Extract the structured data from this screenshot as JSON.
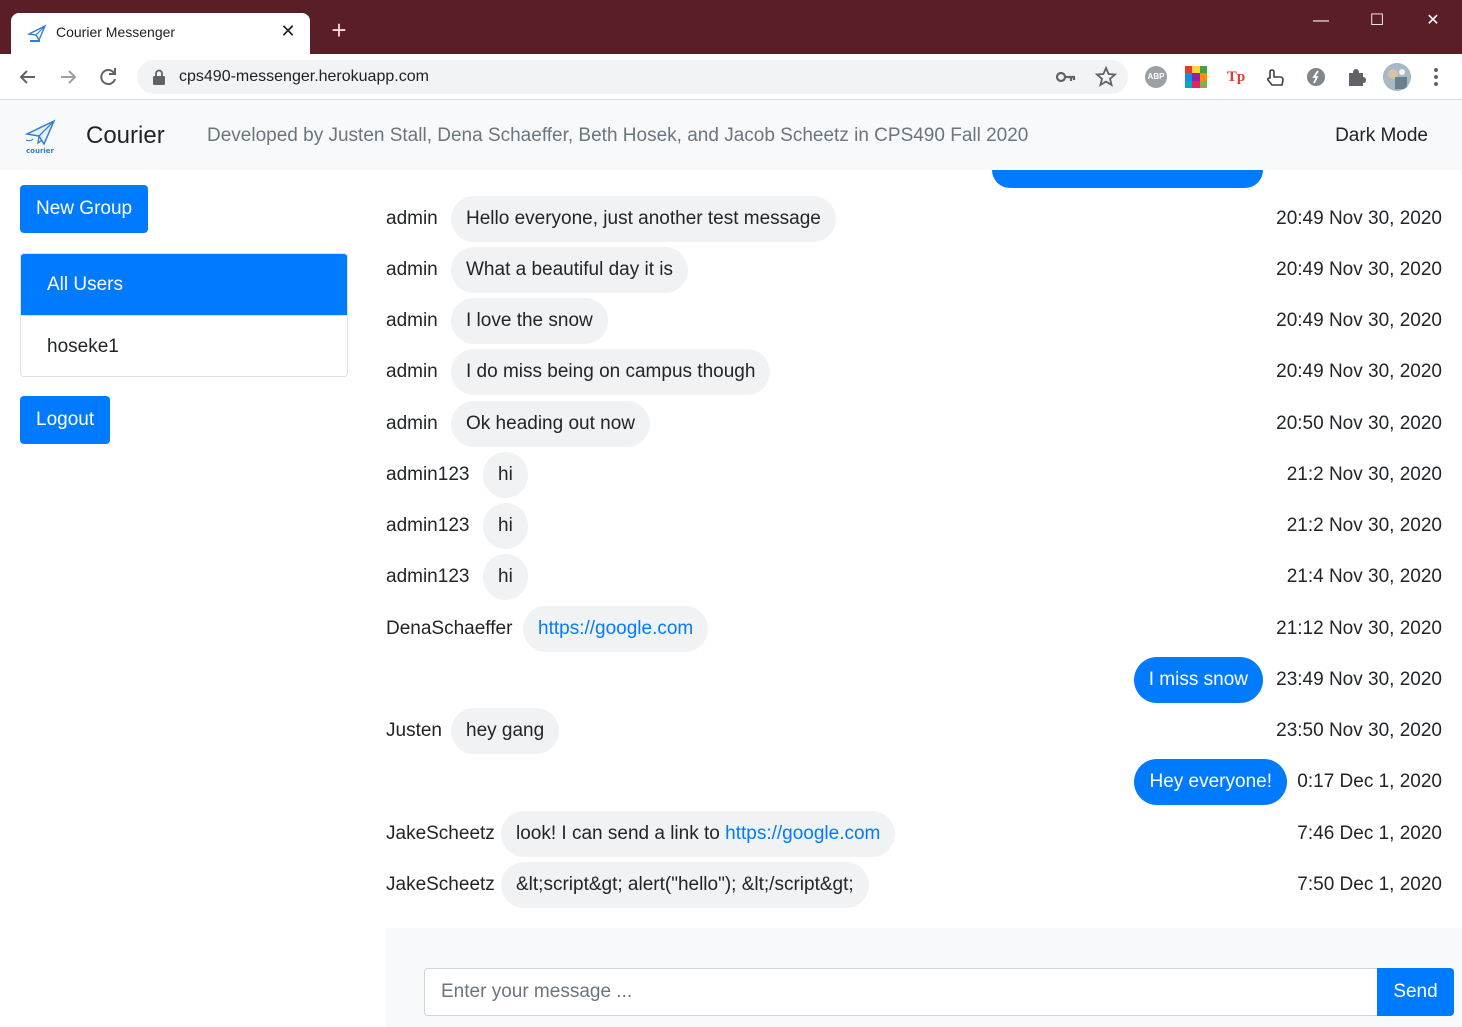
{
  "browser": {
    "tab_title": "Courier Messenger",
    "tab_close": "✕",
    "new_tab": "+",
    "url": "cps490-messenger.herokuapp.com",
    "window_controls": {
      "minimize": "—",
      "maximize": "☐",
      "close": "✕"
    },
    "extensions": [
      {
        "name": "adblock-plus-icon",
        "label": "ABP"
      },
      {
        "name": "color-grid-icon",
        "label": ""
      },
      {
        "name": "tp-icon",
        "label": "Tp"
      }
    ]
  },
  "navbar": {
    "brand_name": "Courier",
    "logo_caption": "courier",
    "developed_by": "Developed by Justen Stall, Dena Schaeffer, Beth Hosek, and Jacob Scheetz in CPS490 Fall 2020",
    "dark_mode": "Dark Mode"
  },
  "sidebar": {
    "new_group_label": "New Group",
    "groups": [
      {
        "label": "All Users",
        "active": true
      },
      {
        "label": "hoseke1",
        "active": false
      }
    ],
    "logout_label": "Logout"
  },
  "messages": [
    {
      "sender": "admin",
      "text": "Hello everyone, just another test message",
      "time": "20:49 Nov 30, 2020",
      "mine": false
    },
    {
      "sender": "admin",
      "text": "What a beautiful day it is",
      "time": "20:49 Nov 30, 2020",
      "mine": false
    },
    {
      "sender": "admin",
      "text": "I love the snow",
      "time": "20:49 Nov 30, 2020",
      "mine": false
    },
    {
      "sender": "admin",
      "text": "I do miss being on campus though",
      "time": "20:49 Nov 30, 2020",
      "mine": false
    },
    {
      "sender": "admin",
      "text": "Ok heading out now",
      "time": "20:50 Nov 30, 2020",
      "mine": false
    },
    {
      "sender": "admin123",
      "text": "hi",
      "time": "21:2 Nov 30, 2020",
      "mine": false
    },
    {
      "sender": "admin123",
      "text": "hi",
      "time": "21:2 Nov 30, 2020",
      "mine": false
    },
    {
      "sender": "admin123",
      "text": "hi",
      "time": "21:4 Nov 30, 2020",
      "mine": false
    },
    {
      "sender": "DenaSchaeffer",
      "text": "",
      "link": "https://google.com",
      "time": "21:12 Nov 30, 2020",
      "mine": false
    },
    {
      "sender": "",
      "text": "I miss snow",
      "time": "23:49 Nov 30, 2020",
      "mine": true
    },
    {
      "sender": "Justen",
      "text": "hey gang",
      "time": "23:50 Nov 30, 2020",
      "mine": false
    },
    {
      "sender": "",
      "text": "Hey everyone!",
      "time": "0:17 Dec 1, 2020",
      "mine": true
    },
    {
      "sender": "JakeScheetz",
      "text": "look! I can send a link to ",
      "link": "https://google.com",
      "time": "7:46 Dec 1, 2020",
      "mine": false
    },
    {
      "sender": "JakeScheetz",
      "text": "&lt;script&gt; alert(\"hello\"); &lt;/script&gt;",
      "time": "7:50 Dec 1, 2020",
      "mine": false
    }
  ],
  "composer": {
    "placeholder": "Enter your message ...",
    "send_label": "Send"
  },
  "colors": {
    "primary": "#007bff",
    "titlebar": "#5a1e26",
    "bubble_other": "#f1f2f4",
    "navbar_bg": "#f8f9fa"
  }
}
